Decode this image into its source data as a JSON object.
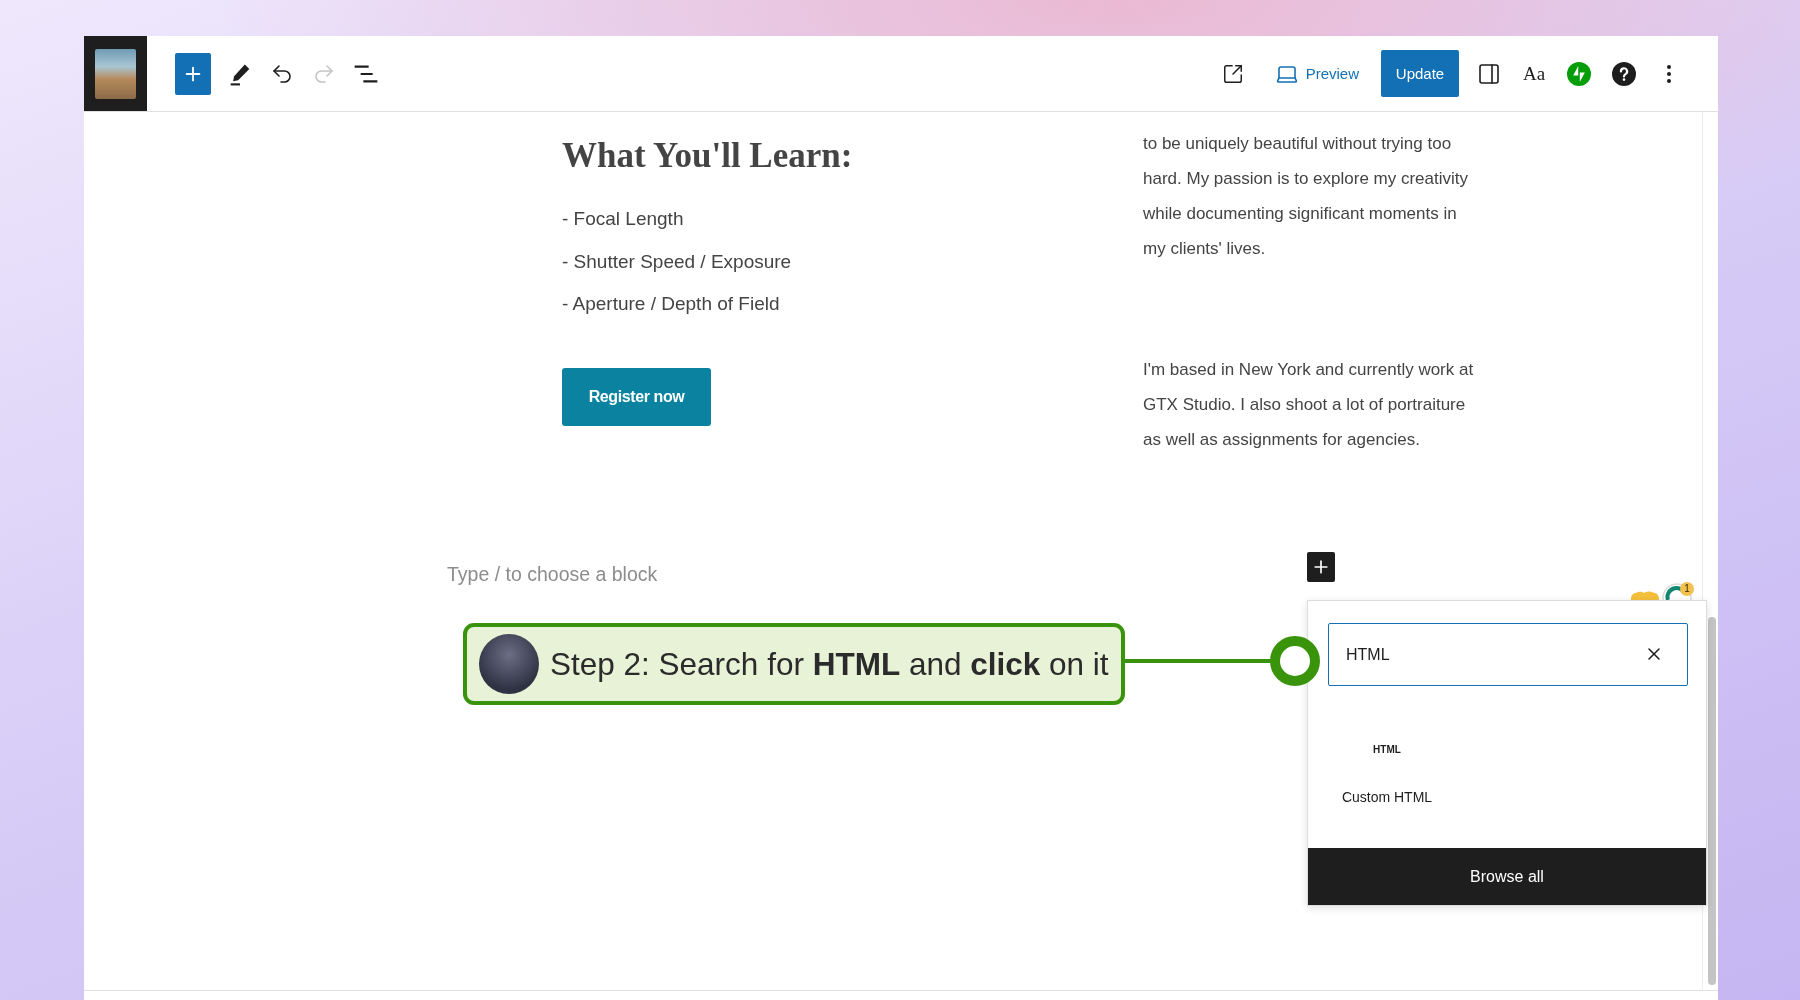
{
  "toolbar": {
    "tools": [
      {
        "kind": "edit",
        "disabled": false
      },
      {
        "kind": "undo",
        "disabled": false
      },
      {
        "kind": "redo",
        "disabled": true
      },
      {
        "kind": "list_view",
        "disabled": false
      }
    ],
    "preview": "Preview",
    "update": "Update",
    "styles": "Aa"
  },
  "content": {
    "heading": "What You'll Learn:",
    "list": [
      "- Focal Length",
      "- Shutter Speed / Exposure",
      "- Aperture / Depth of Field"
    ],
    "button": "Register now",
    "paragraphs": [
      {
        "lines": [
          "to be uniquely beautiful without trying too",
          "hard. My passion is to explore my creativity",
          "while documenting significant moments in",
          "my clients' lives."
        ]
      },
      {
        "lines": [
          "I'm based in New York and currently work at",
          "GTX Studio. I also shoot a lot of portraiture",
          "as well as assignments for agencies."
        ]
      }
    ],
    "block_placeholder": "Type / to choose a block"
  },
  "callout": {
    "text": "Step 2: Search for **HTML** and **click** on it"
  },
  "inserter": {
    "search": {
      "value": "HTML"
    },
    "results": [
      {
        "icon_text": "HTML",
        "label": "Custom HTML"
      }
    ],
    "browse_all": "Browse all"
  },
  "notification": {
    "badge": "1"
  }
}
